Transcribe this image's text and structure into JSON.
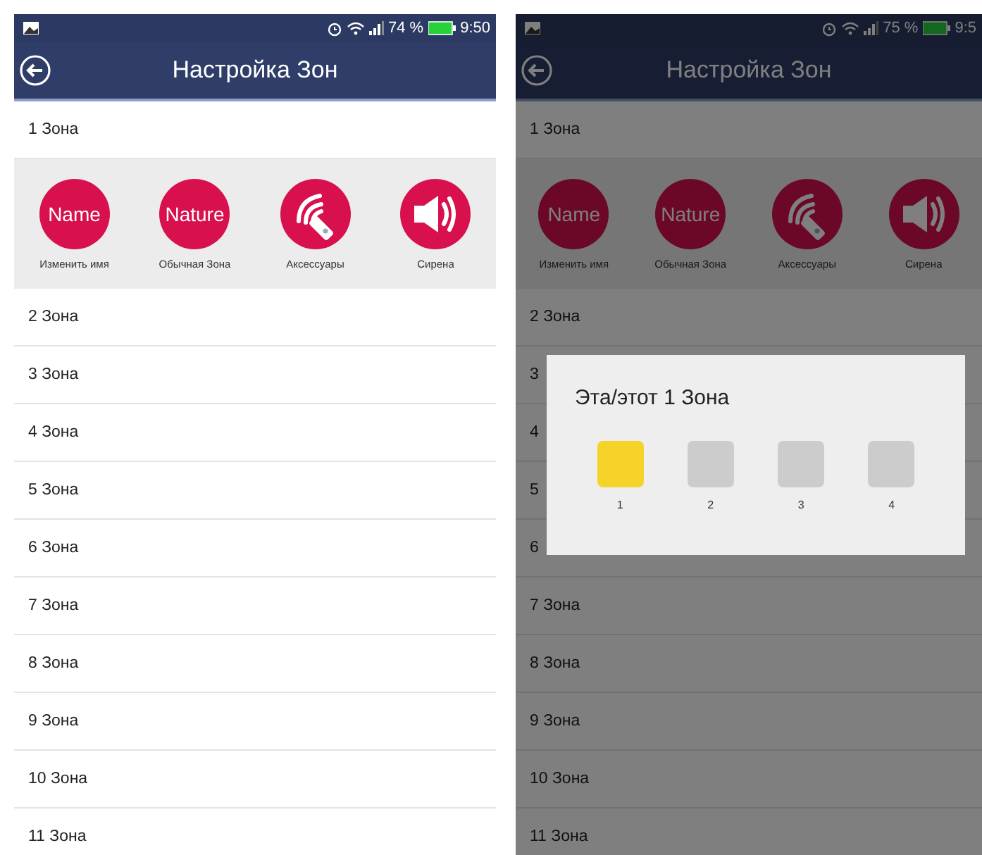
{
  "screens": [
    {
      "dimmed": false,
      "status_bar": {
        "battery": "74 %",
        "time": "9:50"
      },
      "app_bar": {
        "title": "Настройка Зон"
      },
      "zones": [
        {
          "label": "1 Зона",
          "actions": [
            {
              "kind": "text",
              "text": "Name",
              "label": "Изменить имя"
            },
            {
              "kind": "text",
              "text": "Nature",
              "label": "Обычная Зона"
            },
            {
              "kind": "remote",
              "label": "Аксессуары"
            },
            {
              "kind": "siren",
              "label": "Сирена"
            }
          ]
        },
        {
          "label": "2 Зона"
        },
        {
          "label": "3 Зона"
        },
        {
          "label": "4 Зона"
        },
        {
          "label": "5 Зона"
        },
        {
          "label": "6 Зона"
        },
        {
          "label": "7 Зона"
        },
        {
          "label": "8 Зона"
        },
        {
          "label": "9 Зона"
        },
        {
          "label": "10 Зона"
        },
        {
          "label": "11 Зона"
        }
      ]
    },
    {
      "dimmed": true,
      "status_bar": {
        "battery": "75 %",
        "time": "9:5"
      },
      "app_bar": {
        "title": "Настройка Зон"
      },
      "zones": [
        {
          "label": "1 Зона",
          "actions": [
            {
              "kind": "text",
              "text": "Name",
              "label": "Изменить имя"
            },
            {
              "kind": "text",
              "text": "Nature",
              "label": "Обычная Зона"
            },
            {
              "kind": "remote",
              "label": "Аксессуары"
            },
            {
              "kind": "siren",
              "label": "Сирена"
            }
          ]
        },
        {
          "label": "2 Зона"
        },
        {
          "label": "3"
        },
        {
          "label": "4"
        },
        {
          "label": "5"
        },
        {
          "label": "6"
        },
        {
          "label": "7 Зона"
        },
        {
          "label": "8 Зона"
        },
        {
          "label": "9 Зона"
        },
        {
          "label": "10 Зона"
        },
        {
          "label": "11 Зона"
        }
      ],
      "dialog": {
        "title": "Эта/этот 1 Зона",
        "options": [
          {
            "label": "1",
            "selected": true
          },
          {
            "label": "2",
            "selected": false
          },
          {
            "label": "3",
            "selected": false
          },
          {
            "label": "4",
            "selected": false
          }
        ]
      }
    }
  ]
}
